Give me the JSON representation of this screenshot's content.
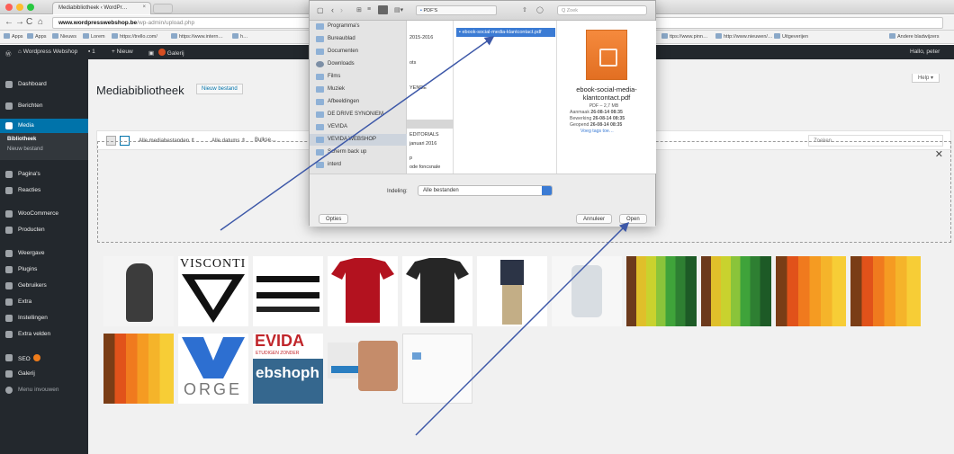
{
  "browser": {
    "tab_title": "Mediabibliotheek ‹ WordPr…",
    "url_host": "www.wordpresswebshop.be",
    "url_path": "/wp-admin/upload.php",
    "bookmarks": [
      "Apps",
      "Apps",
      "Nieuws",
      "Lorem",
      "https://trello.com/",
      "https://www.intern…",
      "h…",
      "ttps://www.pinn…",
      "http://www.nieuwen/…",
      "Uitgeverijen",
      "Andere bladwijzers"
    ]
  },
  "adminbar": {
    "site": "Wordpress Webshop",
    "comments": "1",
    "new": "+ Nieuw",
    "galerij": "Galerij",
    "greeting": "Hallo, peter"
  },
  "sidebar": {
    "items": [
      "Dashboard",
      "Berichten",
      "Media",
      "Pagina's",
      "Reacties",
      "WooCommerce",
      "Producten",
      "Weergave",
      "Plugins",
      "Gebruikers",
      "Extra",
      "Instellingen",
      "Extra velden",
      "SEO",
      "Galerij",
      "Menu invouwen"
    ],
    "sub": [
      "Bibliotheek",
      "Nieuw bestand"
    ]
  },
  "main": {
    "title": "Mediabibliotheek",
    "add_new": "Nieuw bestand",
    "help": "Help ▾",
    "filter_type": "Alle mediabestanden ⇕",
    "filter_date": "Alle datums ⇕",
    "bulk": "Bulkse…",
    "search_placeholder": "Zoeken"
  },
  "dialog": {
    "folder": "PDF'S",
    "search": "Q Zoek",
    "sidebar": [
      "Programma's",
      "Bureaublad",
      "Documenten",
      "Downloads",
      "Films",
      "Muziek",
      "Afbeeldingen",
      "DE DRIVE SYNONIEM",
      "VEVIDA",
      "VEVIDA WEBSHOP",
      "Scherm back up",
      "interd"
    ],
    "col1": [
      "2015-2016",
      "",
      "ots",
      "",
      "YENDE",
      "",
      "",
      "",
      "EDITORIALS",
      "januari 2016",
      "",
      "p",
      "ode foncsnale"
    ],
    "selected_file": "ebook-social-media-klantcontact.pdf",
    "preview_name": "ebook-social-media-klantcontact.pdf",
    "preview_kind": "PDF – 2,7 MB",
    "meta": [
      {
        "k": "Aanmaak",
        "v": "26-08-14 08:35"
      },
      {
        "k": "Bewerking",
        "v": "26-08-14 08:35"
      },
      {
        "k": "Geopend",
        "v": "26-08-14 08:35"
      }
    ],
    "more_tags": "Voeg tags toe…",
    "format_label": "Indeling:",
    "format_value": "Alle bestanden",
    "options": "Opties",
    "cancel": "Annuleer",
    "open": "Open"
  },
  "thumbs": [
    {
      "label": "portrait-photo",
      "caption": ""
    },
    {
      "label": "visconti-logo",
      "caption": "VISCONTI"
    },
    {
      "label": "belts",
      "caption": ""
    },
    {
      "label": "red-tshirt",
      "caption": ""
    },
    {
      "label": "black-tshirt",
      "caption": ""
    },
    {
      "label": "man-khaki",
      "caption": ""
    },
    {
      "label": "illustration",
      "caption": ""
    },
    {
      "label": "colorful-pencils",
      "caption": ""
    },
    {
      "label": "colorful-pencils-2",
      "caption": ""
    },
    {
      "label": "orange-pencils",
      "caption": ""
    },
    {
      "label": "orange-pencils-2",
      "caption": ""
    },
    {
      "label": "orange-pencils-3",
      "caption": ""
    },
    {
      "label": "vorge-logo",
      "caption": "ORGE"
    },
    {
      "label": "vevida-webshop",
      "caption": "EVIDA"
    },
    {
      "label": "marketing-man",
      "caption": ""
    },
    {
      "label": "small-logo",
      "caption": ""
    }
  ],
  "thumb_texts": {
    "vevida_sub": "ebshoph",
    "vevida_small": "ETUDIGEN ZONDER"
  }
}
